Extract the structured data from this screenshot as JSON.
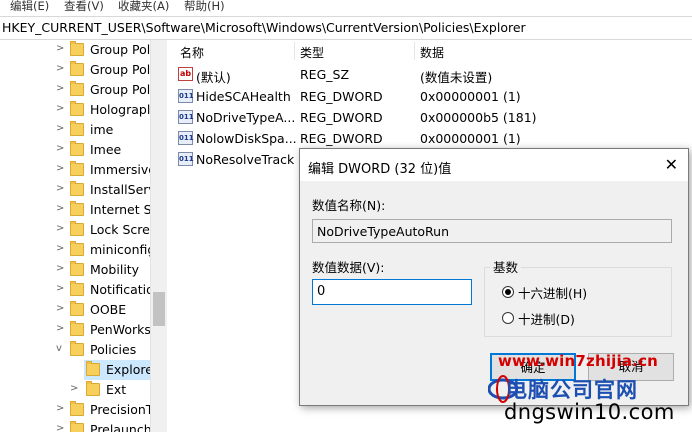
{
  "menu": [
    "编辑(E)",
    "查看(V)",
    "收藏夹(A)",
    "帮助(H)"
  ],
  "path": "HKEY_CURRENT_USER\\Software\\Microsoft\\Windows\\CurrentVersion\\Policies\\Explorer",
  "tree": [
    {
      "label": "Group Pol",
      "chevron": ">"
    },
    {
      "label": "Group Pol",
      "chevron": ">"
    },
    {
      "label": "Group Pol",
      "chevron": ">"
    },
    {
      "label": "Holograpl",
      "chevron": ">"
    },
    {
      "label": "ime",
      "chevron": ">"
    },
    {
      "label": "Imee",
      "chevron": ">"
    },
    {
      "label": "Immersive",
      "chevron": ">"
    },
    {
      "label": "InstallServ",
      "chevron": ">"
    },
    {
      "label": "Internet Se",
      "chevron": ">"
    },
    {
      "label": "Lock Scree",
      "chevron": ">"
    },
    {
      "label": "miniconfig",
      "chevron": ">"
    },
    {
      "label": "Mobility",
      "chevron": ">"
    },
    {
      "label": "Notificatio",
      "chevron": ">"
    },
    {
      "label": "OOBE",
      "chevron": ">"
    },
    {
      "label": "PenWorks",
      "chevron": ">"
    },
    {
      "label": "Policies",
      "chevron": "v"
    },
    {
      "label": "Explore",
      "chevron": "",
      "selected": true
    },
    {
      "label": "Ext",
      "chevron": ">"
    },
    {
      "label": "PrecisionT",
      "chevron": ">"
    },
    {
      "label": "Prelaunch",
      "chevron": ">"
    }
  ],
  "columns": {
    "name": "名称",
    "type": "类型",
    "data": "数据"
  },
  "values": [
    {
      "icon": "ab",
      "name": "(默认)",
      "type": "REG_SZ",
      "data": "(数值未设置)"
    },
    {
      "icon": "bin",
      "name": "HideSCAHealth",
      "type": "REG_DWORD",
      "data": "0x00000001 (1)"
    },
    {
      "icon": "bin",
      "name": "NoDriveTypeA...",
      "type": "REG_DWORD",
      "data": "0x000000b5 (181)"
    },
    {
      "icon": "bin",
      "name": "NolowDiskSpa...",
      "type": "REG_DWORD",
      "data": "0x00000001 (1)"
    },
    {
      "icon": "bin",
      "name": "NoResolveTrack",
      "type": "",
      "data": ""
    }
  ],
  "dialog": {
    "title": "编辑 DWORD (32 位)值",
    "close": "✕",
    "name_label": "数值名称(N):",
    "name_value": "NoDriveTypeAutoRun",
    "data_label": "数值数据(V):",
    "data_value": "0",
    "base_label": "基数",
    "hex_label": "十六进制(H)",
    "dec_label": "十进制(D)",
    "base_selected": "hex",
    "ok": "确定",
    "cancel": "取消"
  },
  "watermark": {
    "url": "www.win7zhijia.cn",
    "cn": "电脑公司官网",
    "domain": "dngswin10.com"
  }
}
